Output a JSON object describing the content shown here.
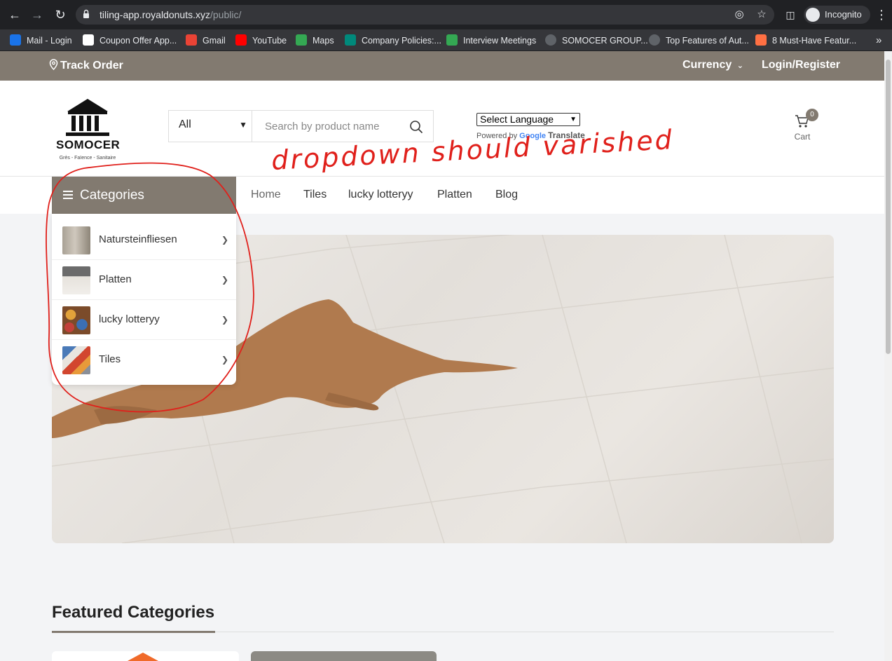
{
  "browser": {
    "url_host": "tiling-app.royaldonuts.xyz",
    "url_path": "/public/",
    "incognito_label": "Incognito",
    "bookmarks": [
      {
        "label": "Mail - Login",
        "color": "#1a73e8"
      },
      {
        "label": "Coupon Offer App...",
        "color": "#ffffff"
      },
      {
        "label": "Gmail",
        "color": "#ea4335"
      },
      {
        "label": "YouTube",
        "color": "#ff0000"
      },
      {
        "label": "Maps",
        "color": "#34a853"
      },
      {
        "label": "Company Policies:...",
        "color": "#00897b"
      },
      {
        "label": "Interview Meetings",
        "color": "#34a853"
      },
      {
        "label": "SOMOCER GROUP...",
        "color": "#5f6368"
      },
      {
        "label": "Top Features of Aut...",
        "color": "#5f6368"
      },
      {
        "label": "8 Must-Have Featur...",
        "color": "#ff7043"
      }
    ]
  },
  "topbar": {
    "track_order": "Track Order",
    "currency": "Currency",
    "login": "Login/Register",
    "color": "#827a70"
  },
  "header": {
    "logo_text": "SOMOCER",
    "logo_sub": "Grès - Faïence - Sanitaire",
    "search_category": "All",
    "search_placeholder": "Search by product name",
    "language_select": "Select Language",
    "powered_by": "Powered by",
    "google": "Google",
    "translate": "Translate",
    "cart_count": "0",
    "cart_label": "Cart"
  },
  "nav": {
    "categories_title": "Categories",
    "links": [
      "Home",
      "Tiles",
      "lucky lotteryy",
      "Platten",
      "Blog"
    ]
  },
  "categories": [
    {
      "label": "Natursteinfliesen"
    },
    {
      "label": "Platten"
    },
    {
      "label": "lucky lotteryy"
    },
    {
      "label": "Tiles"
    }
  ],
  "featured": {
    "title": "Featured Categories"
  },
  "annotation": {
    "text": "dropdown should varished",
    "color": "#e0201b"
  }
}
